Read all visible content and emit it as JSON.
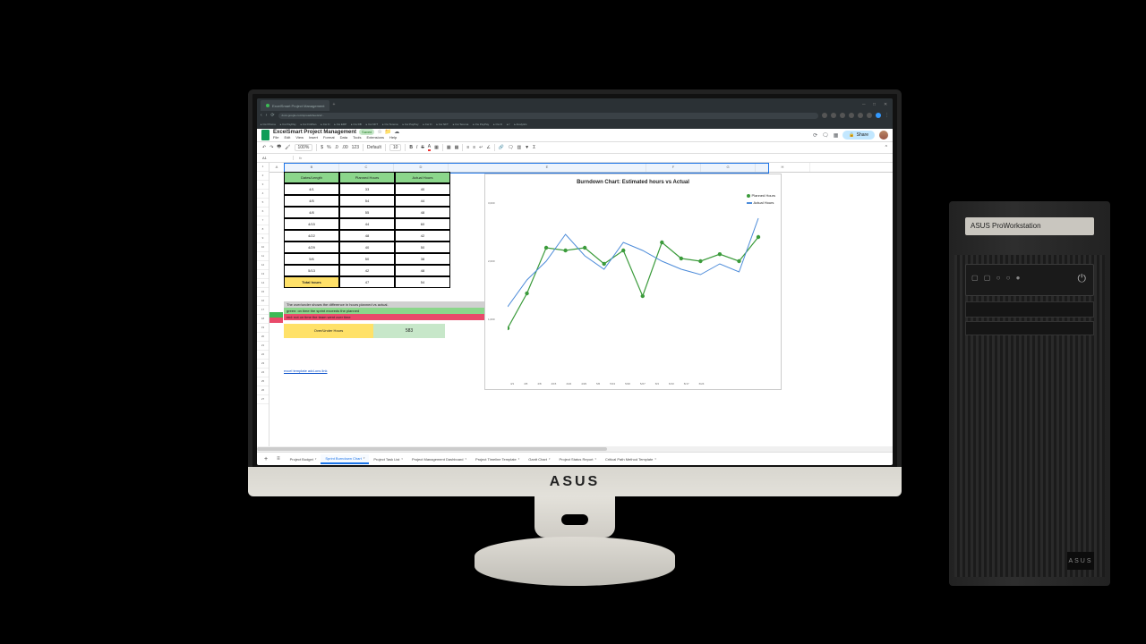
{
  "hardware": {
    "monitor_brand": "ASUS",
    "tower_label": "ASUS ProWorkstation",
    "tower_logo": "ASUS",
    "power_glyph": "⏻"
  },
  "browser": {
    "tab_title": "ExcelSmart Project Management",
    "url": "docs.google.com/spreadsheets/d/…",
    "win_controls": [
      "─",
      "□",
      "✕"
    ],
    "nav": {
      "back": "‹",
      "fwd": "›",
      "reload": "⟳"
    },
    "bookmarks": [
      "Cw Prisma",
      "Cw PayPay",
      "Cw FinPlan",
      "Cw Fi",
      "Cw ERP",
      "Cw DB",
      "Cw NFT",
      "Cw Terema",
      "Cw PayPay",
      "Cw Fi",
      "Cw NFT",
      "Cw Terema",
      "Cw PayPay",
      "Cw Fi",
      "f",
      "Analytics"
    ]
  },
  "sheets": {
    "doc_title": "ExcelSmart Project Management",
    "save_state": "Saved",
    "star": "☆",
    "folder": "📁",
    "cloud": "☁",
    "menus": [
      "File",
      "Edit",
      "View",
      "Insert",
      "Format",
      "Data",
      "Tools",
      "Extensions",
      "Help"
    ],
    "header_icons": {
      "history": "⟳",
      "comment": "🗨",
      "meet": "▦"
    },
    "share_label": "Share",
    "share_icon": "🔒",
    "toolbar": {
      "undo": "↶",
      "redo": "↷",
      "print": "🖶",
      "paint": "🖌",
      "zoom": "100%",
      "currency": "$",
      "percent": "%",
      "dec1": ".0",
      "dec2": ".00",
      "more123": "123",
      "font": "Default",
      "fontsz": "10",
      "bold": "B",
      "italic": "I",
      "strike": "S",
      "color": "A",
      "fill": "▦",
      "border": "▦",
      "merge": "▦",
      "halign": "≡",
      "valign": "≡",
      "wrap": "↵",
      "rotate": "∠",
      "link": "🔗",
      "cmt": "🗨",
      "chart": "▥",
      "filter": "▼",
      "func": "Σ",
      "up": "^"
    },
    "formula_bar": {
      "cell": "A1",
      "fx": "fx",
      "value": ""
    },
    "columns": [
      "A",
      "B",
      "C",
      "D",
      "E",
      "F",
      "G",
      "H"
    ],
    "row_numbers": [
      "1",
      "2",
      "3",
      "4",
      "5",
      "6",
      "7",
      "8",
      "9",
      "10",
      "11",
      "12",
      "13",
      "14",
      "15",
      "16",
      "17",
      "18",
      "19",
      "20",
      "21",
      "22",
      "23",
      "24",
      "25",
      "26",
      "27"
    ],
    "table": {
      "headers": [
        "Dates/Length",
        "Planned Hours",
        "Actual Hours"
      ],
      "rows": [
        [
          "4/1",
          "33",
          "40"
        ],
        [
          "4/5",
          "54",
          "44"
        ],
        [
          "4/8",
          "55",
          "48"
        ],
        [
          "4/15",
          "44",
          "60"
        ],
        [
          "4/22",
          "48",
          "42"
        ],
        [
          "4/29",
          "40",
          "50"
        ],
        [
          "5/6",
          "50",
          "38"
        ],
        [
          "5/13",
          "42",
          "48"
        ]
      ],
      "total_label": "Total hours",
      "total_planned": "47",
      "total_actual": "54"
    },
    "legend": {
      "title": "The over/under shows the difference in hours planned vs actual.",
      "green": "green: on time the sprint exceeds the planned",
      "red": "red: not on time the team went over time"
    },
    "over_under": {
      "label": "Over/Under Hours",
      "value": "583"
    },
    "link_text": "excel template add-ons link",
    "sheet_tabs": [
      "Project Budget",
      "Sprint Burndown Chart",
      "Project Task List",
      "Project Management Dashboard",
      "Project Timeline Template",
      "Gantt Chart",
      "Project Status Report",
      "Critical Path Method Template"
    ],
    "active_tab_index": 1,
    "plus": "+",
    "menu": "≡"
  },
  "chart_data": {
    "type": "line",
    "title": "Burndown Chart: Estimated hours vs Actual",
    "x": [
      "4/1",
      "4/5",
      "4/8",
      "4/15",
      "4/22",
      "4/29",
      "5/6",
      "5/13",
      "5/20",
      "5/27",
      "6/3",
      "6/10",
      "6/17",
      "6/24"
    ],
    "series": [
      {
        "name": "Planned Hours",
        "color": "#3b9b3b",
        "values": [
          600,
          1250,
          2100,
          2050,
          2100,
          1800,
          2050,
          1200,
          2200,
          1900,
          1850,
          1980,
          1850,
          2300
        ]
      },
      {
        "name": "Actual Hours",
        "color": "#4c8bd9",
        "values": [
          1000,
          1500,
          1850,
          2350,
          1950,
          1700,
          2200,
          2050,
          1850,
          1700,
          1600,
          1800,
          1650,
          2650
        ]
      }
    ],
    "ylim": [
      0,
      3000
    ],
    "yticks": [
      "1,000",
      "2,000",
      "3,000"
    ],
    "xlabel": "",
    "ylabel": ""
  }
}
